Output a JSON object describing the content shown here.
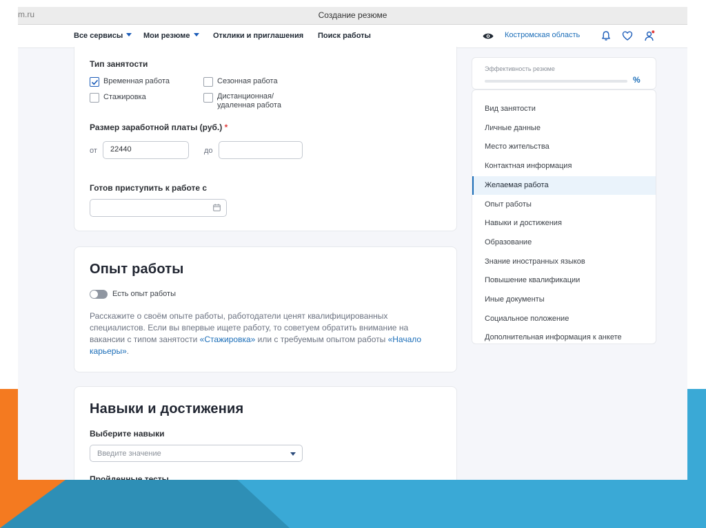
{
  "browser": {
    "url_fragment": "m.ru",
    "title": "Создание резюме"
  },
  "nav": {
    "items": [
      "Все сервисы",
      "Мои резюме",
      "Отклики и приглашения",
      "Поиск работы"
    ],
    "region": "Костромская область"
  },
  "employment": {
    "title": "Тип занятости",
    "options": [
      {
        "label": "Временная работа",
        "checked": true
      },
      {
        "label": "Сезонная работа",
        "checked": false
      },
      {
        "label": "Стажировка",
        "checked": false
      },
      {
        "label_line1": "Дистанционная/",
        "label_line2": "удаленная работа",
        "checked": false
      }
    ]
  },
  "salary": {
    "label": "Размер заработной платы (руб.)",
    "required_mark": "*",
    "from_label": "от",
    "from_value": "22440",
    "to_label": "до",
    "to_value": ""
  },
  "start": {
    "label": "Готов приступить к работе с",
    "value": ""
  },
  "experience": {
    "title": "Опыт работы",
    "toggle_label": "Есть опыт работы",
    "toggle_on": false,
    "text_1": "Расскажите о своём опыте работы, работодатели ценят квалифицированных специалистов. Если вы впервые ищете работу, то советуем обратить внимание на вакансии с типом занятости ",
    "link_1": "«Стажировка»",
    "text_2": " или с требуемым опытом работы ",
    "link_2": "«Начало карьеры»",
    "text_3": "."
  },
  "skills": {
    "title": "Навыки и достижения",
    "select_label": "Выберите навыки",
    "select_placeholder": "Введите значение",
    "tests_label": "Пройденные тесты"
  },
  "efficiency": {
    "label": "Эффективность резюме",
    "percent_sign": "%",
    "progress": 0
  },
  "sidebar": {
    "items": [
      "Вид занятости",
      "Личные данные",
      "Место жительства",
      "Контактная информация",
      "Желаемая работа",
      "Опыт работы",
      "Навыки и достижения",
      "Образование",
      "Знание иностранных языков",
      "Повышение квалификации",
      "Иные документы",
      "Социальное положение",
      "Дополнительная информация к анкете"
    ],
    "active_index": 4
  },
  "colors": {
    "accent": "#1a6db8",
    "slide_orange": "#f47a20",
    "slide_blue": "#3aa9d6",
    "required": "#e03a3a"
  },
  "icons": [
    "eye-icon",
    "bell-icon",
    "heart-icon",
    "user-icon",
    "calendar-icon",
    "checkmark-icon",
    "chevron-down-icon"
  ]
}
